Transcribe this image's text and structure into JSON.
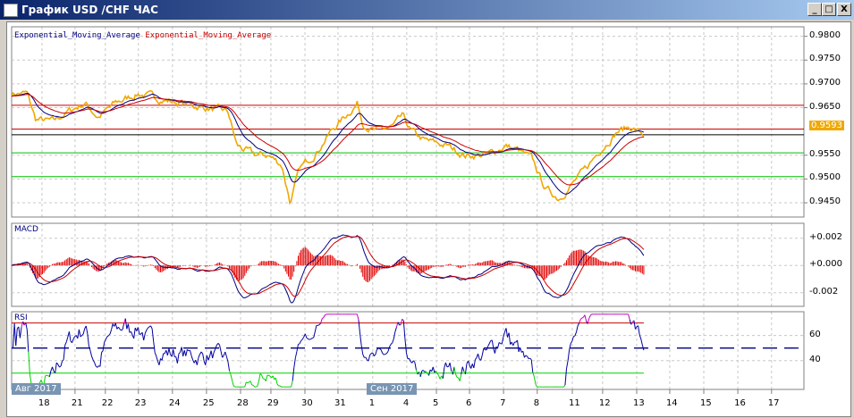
{
  "window": {
    "title": "График USD /CHF  ЧАС",
    "minimize": "_",
    "maximize": "□",
    "close": "X"
  },
  "legend": {
    "ema_fast": "Exponential_Moving_Average",
    "ema_slow": "Exponential_Moving_Average"
  },
  "panels": {
    "macd_label": "MACD",
    "rsi_label": "RSI"
  },
  "month_tags": [
    "Авг 2017",
    "Сен 2017"
  ],
  "colors": {
    "price": "#f0a800",
    "ema_fast": "#000080",
    "ema_slow": "#cc0000",
    "level_red": "#cc0000",
    "level_green": "#00c000",
    "current": "#000000"
  },
  "chart_data": [
    {
      "type": "line",
      "title": "USD/CHF H1",
      "ylim": [
        0.942,
        0.982
      ],
      "yticks": [
        "0.9800",
        "0.9750",
        "0.9700",
        "0.9650",
        "0.9550",
        "0.9500",
        "0.9450"
      ],
      "current_price": "0.9593",
      "levels": {
        "resistance": [
          0.9655,
          0.9605
        ],
        "support": [
          0.9555,
          0.9505
        ],
        "current": 0.9593
      },
      "x_unit": "trading days from 18 Aug",
      "xlim": [
        -0.9,
        22.6
      ],
      "xticks": [
        {
          "t": 0,
          "label": "18"
        },
        {
          "t": 0.98,
          "label": "21"
        },
        {
          "t": 1.88,
          "label": "22"
        },
        {
          "t": 2.86,
          "label": "23"
        },
        {
          "t": 3.87,
          "label": "24"
        },
        {
          "t": 4.88,
          "label": "25"
        },
        {
          "t": 5.89,
          "label": "28"
        },
        {
          "t": 6.79,
          "label": "29"
        },
        {
          "t": 7.8,
          "label": "30"
        },
        {
          "t": 8.78,
          "label": "31"
        },
        {
          "t": 9.81,
          "label": "1"
        },
        {
          "t": 10.82,
          "label": "4"
        },
        {
          "t": 11.7,
          "label": "5"
        },
        {
          "t": 12.68,
          "label": "6"
        },
        {
          "t": 13.69,
          "label": "7"
        },
        {
          "t": 14.69,
          "label": "8"
        },
        {
          "t": 15.73,
          "label": "11"
        },
        {
          "t": 16.63,
          "label": "12"
        },
        {
          "t": 17.64,
          "label": "13"
        },
        {
          "t": 18.62,
          "label": "14"
        },
        {
          "t": 19.63,
          "label": "15"
        },
        {
          "t": 20.64,
          "label": "16"
        },
        {
          "t": 21.64,
          "label": "17"
        }
      ],
      "series": [
        {
          "name": "price",
          "t": [
            -0.9,
            -0.45,
            -0.19,
            0.34,
            0.74,
            1.27,
            1.67,
            2.2,
            2.86,
            3.4,
            4.06,
            4.85,
            5.52,
            5.78,
            6.31,
            6.71,
            7.11,
            7.37,
            7.64,
            8.17,
            8.57,
            8.97,
            9.36,
            9.5,
            9.89,
            10.42,
            10.69,
            10.95,
            11.35,
            12.02,
            12.55,
            13.21,
            13.74,
            14.14,
            14.54,
            14.93,
            15.33,
            15.73,
            16.13,
            16.53,
            17.06,
            17.45,
            17.85
          ],
          "values": [
            0.968,
            0.968,
            0.9625,
            0.962,
            0.964,
            0.966,
            0.963,
            0.966,
            0.968,
            0.967,
            0.966,
            0.965,
            0.964,
            0.957,
            0.955,
            0.955,
            0.953,
            0.945,
            0.952,
            0.956,
            0.96,
            0.963,
            0.966,
            0.962,
            0.96,
            0.961,
            0.963,
            0.96,
            0.958,
            0.957,
            0.955,
            0.955,
            0.957,
            0.956,
            0.954,
            0.948,
            0.946,
            0.949,
            0.952,
            0.956,
            0.96,
            0.961,
            0.9593
          ]
        }
      ]
    },
    {
      "type": "line",
      "title": "MACD",
      "ylim": [
        -0.003,
        0.0031
      ],
      "yticks": [
        "+0.002",
        "+0.000",
        "-0.002"
      ]
    },
    {
      "type": "line",
      "title": "RSI",
      "ylim": [
        17,
        79
      ],
      "yticks": [
        "60",
        "40"
      ],
      "levels": [
        70,
        50,
        30
      ]
    }
  ]
}
